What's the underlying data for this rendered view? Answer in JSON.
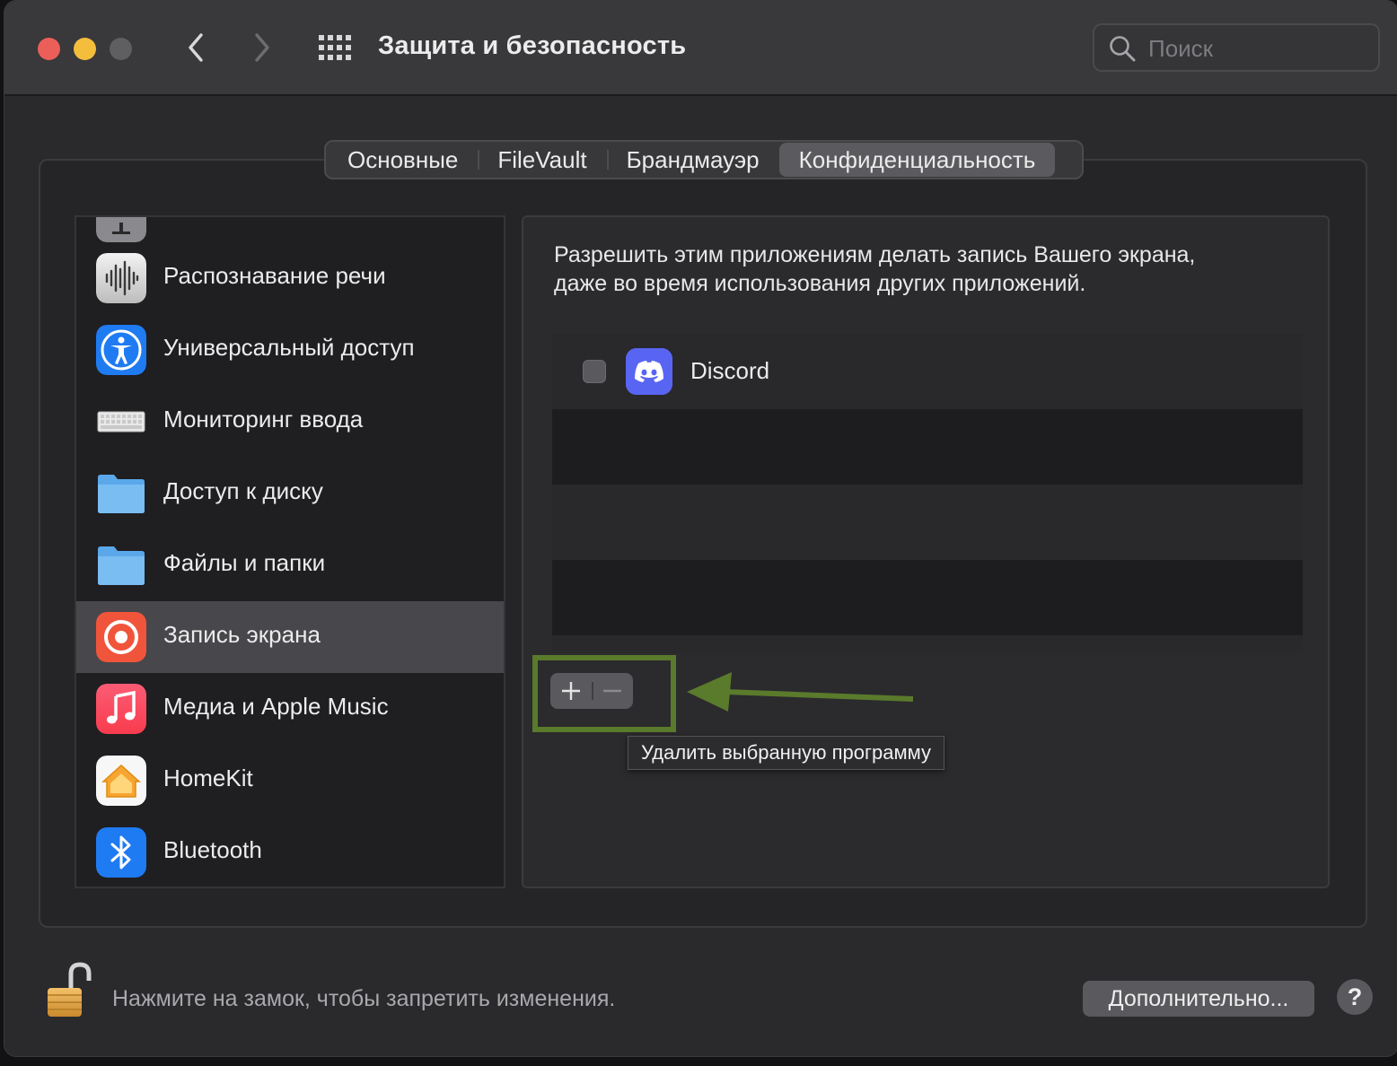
{
  "window": {
    "title": "Защита и безопасность",
    "search_placeholder": "Поиск",
    "traffic_lights": {
      "close": "#ec5f59",
      "minimize": "#f4bd3c",
      "zoom": "#5f5e61"
    }
  },
  "toolbar": {
    "back_icon": "chevron-left-icon",
    "forward_icon": "chevron-right-icon",
    "grid_icon": "grid-icon"
  },
  "tabs": [
    {
      "label": "Основные",
      "active": false
    },
    {
      "label": "FileVault",
      "active": false
    },
    {
      "label": "Брандмауэр",
      "active": false
    },
    {
      "label": "Конфиденциальность",
      "active": true
    }
  ],
  "sidebar": {
    "items": [
      {
        "label": "",
        "icon": "partial-icon"
      },
      {
        "label": "Распознавание речи",
        "icon": "speech-recognition-icon"
      },
      {
        "label": "Универсальный доступ",
        "icon": "accessibility-icon"
      },
      {
        "label": "Мониторинг ввода",
        "icon": "keyboard-icon"
      },
      {
        "label": "Доступ к диску",
        "icon": "folder-icon"
      },
      {
        "label": "Файлы и папки",
        "icon": "folder-icon"
      },
      {
        "label": "Запись экрана",
        "icon": "screen-recording-icon",
        "selected": true
      },
      {
        "label": "Медиа и Apple Music",
        "icon": "music-icon"
      },
      {
        "label": "HomeKit",
        "icon": "home-icon"
      },
      {
        "label": "Bluetooth",
        "icon": "bluetooth-icon"
      }
    ]
  },
  "content": {
    "description_line1": "Разрешить этим приложениям делать запись Вашего экрана,",
    "description_line2": "даже во время использования других приложений.",
    "apps": [
      {
        "name": "Discord",
        "checked": false,
        "icon": "discord-icon"
      }
    ],
    "add_button": "+",
    "remove_button": "—",
    "tooltip": "Удалить выбранную программу"
  },
  "annotation": {
    "color": "#5a7a2c"
  },
  "footer": {
    "lock_text": "Нажмите на замок, чтобы запретить изменения.",
    "advanced_button": "Дополнительно...",
    "help_button": "?"
  }
}
